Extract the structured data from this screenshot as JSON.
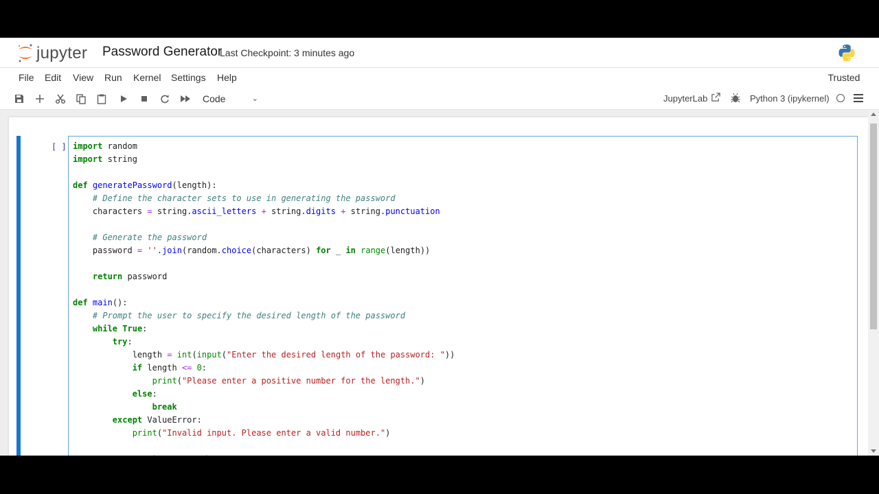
{
  "app": {
    "logo_text": "jupyter",
    "notebook_title": "Password Generator",
    "checkpoint": "Last Checkpoint: 3 minutes ago"
  },
  "menu": {
    "items": [
      "File",
      "Edit",
      "View",
      "Run",
      "Kernel",
      "Settings",
      "Help"
    ],
    "trusted": "Trusted"
  },
  "toolbar": {
    "cell_type": "Code",
    "jupyterlab_link": "JupyterLab",
    "kernel": "Python 3 (ipykernel)"
  },
  "cell": {
    "prompt": "[ ]:",
    "lines": [
      "import random",
      "import string",
      "",
      "def generatePassword(length):",
      "    # Define the character sets to use in generating the password",
      "    characters = string.ascii_letters + string.digits + string.punctuation",
      "",
      "    # Generate the password",
      "    password = ''.join(random.choice(characters) for _ in range(length))",
      "",
      "    return password",
      "",
      "def main():",
      "    # Prompt the user to specify the desired length of the password",
      "    while True:",
      "        try:",
      "            length = int(input(\"Enter the desired length of the password: \"))",
      "            if length <= 0:",
      "                print(\"Please enter a positive number for the length.\")",
      "            else:",
      "                break",
      "        except ValueError:",
      "            print(\"Invalid input. Please enter a valid number.\")",
      "",
      "    # Generate the password"
    ]
  },
  "colors": {
    "accent": "#1976d2",
    "keyword": "#008000",
    "comment": "#408080",
    "string": "#ba2121",
    "function": "#0000ff",
    "operator": "#aa22ff"
  },
  "icons": {
    "toolbar": [
      "save-icon",
      "add-cell-icon",
      "cut-icon",
      "copy-icon",
      "paste-icon",
      "run-icon",
      "stop-icon",
      "restart-icon",
      "run-all-icon"
    ],
    "cell": [
      "duplicate-icon",
      "move-up-icon",
      "move-down-icon",
      "insert-above-icon",
      "insert-below-icon",
      "delete-icon"
    ]
  }
}
